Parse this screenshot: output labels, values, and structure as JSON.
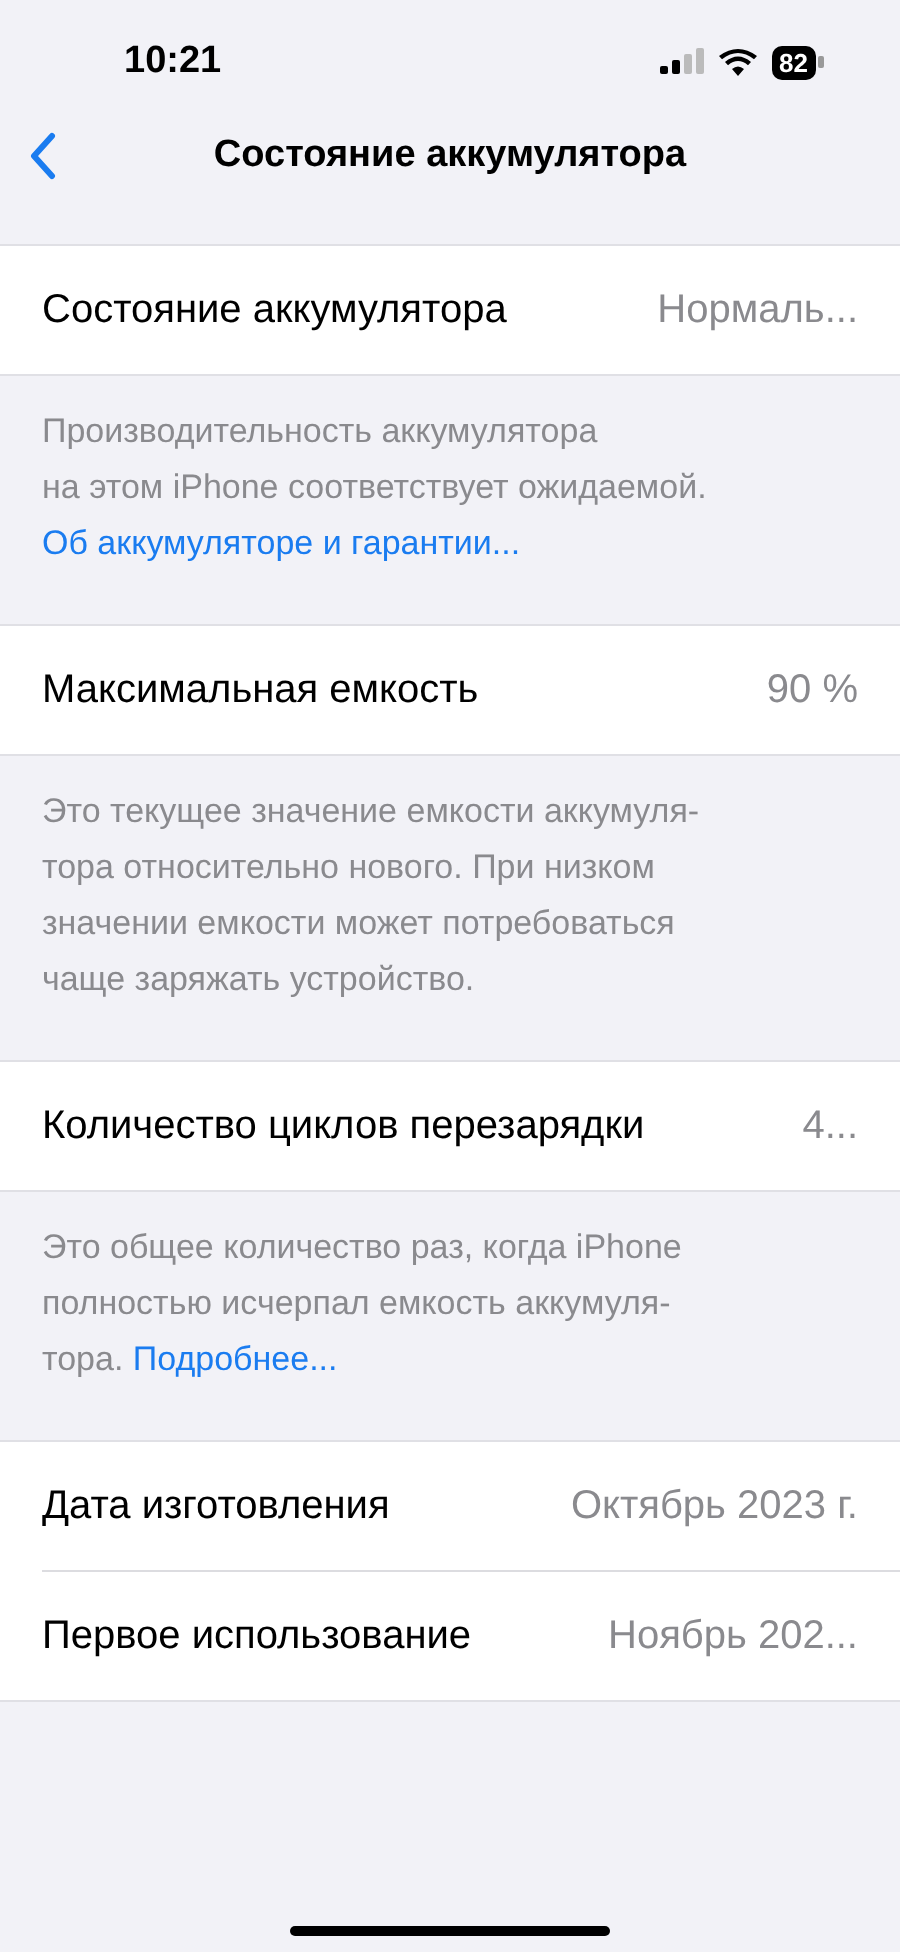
{
  "status_bar": {
    "time": "10:21",
    "battery": "82"
  },
  "nav": {
    "title": "Состояние аккумулятора"
  },
  "sections": [
    {
      "rows": [
        {
          "label": "Состояние аккумулятора",
          "value": "Нормаль..."
        }
      ],
      "footer": [
        [
          {
            "kind": "text",
            "text": "Производительность аккумулятора"
          }
        ],
        [
          {
            "kind": "text",
            "text": "на этом iPhone соответствует ожидаемой."
          }
        ],
        [
          {
            "kind": "link",
            "text": "Об аккумуляторе и гарантии..."
          }
        ]
      ]
    },
    {
      "rows": [
        {
          "label": "Максимальная емкость",
          "value": "90 %"
        }
      ],
      "footer": [
        [
          {
            "kind": "text",
            "text": "Это текущее значение емкости аккумуля-"
          }
        ],
        [
          {
            "kind": "text",
            "text": "тора относительно нового. При низком"
          }
        ],
        [
          {
            "kind": "text",
            "text": "значении емкости может потребоваться"
          }
        ],
        [
          {
            "kind": "text",
            "text": "чаще заряжать устройство."
          }
        ]
      ]
    },
    {
      "rows": [
        {
          "label": "Количество циклов перезарядки",
          "value": "4..."
        }
      ],
      "footer": [
        [
          {
            "kind": "text",
            "text": "Это общее количество раз, когда iPhone"
          }
        ],
        [
          {
            "kind": "text",
            "text": "полностью исчерпал емкость аккумуля-"
          }
        ],
        [
          {
            "kind": "text",
            "text": "тора. "
          },
          {
            "kind": "link",
            "text": "Подробнее..."
          }
        ]
      ]
    },
    {
      "rows": [
        {
          "label": "Дата изготовления",
          "value": "Октябрь 2023 г."
        },
        {
          "label": "Первое использование",
          "value": "Ноябрь 202..."
        }
      ]
    }
  ]
}
